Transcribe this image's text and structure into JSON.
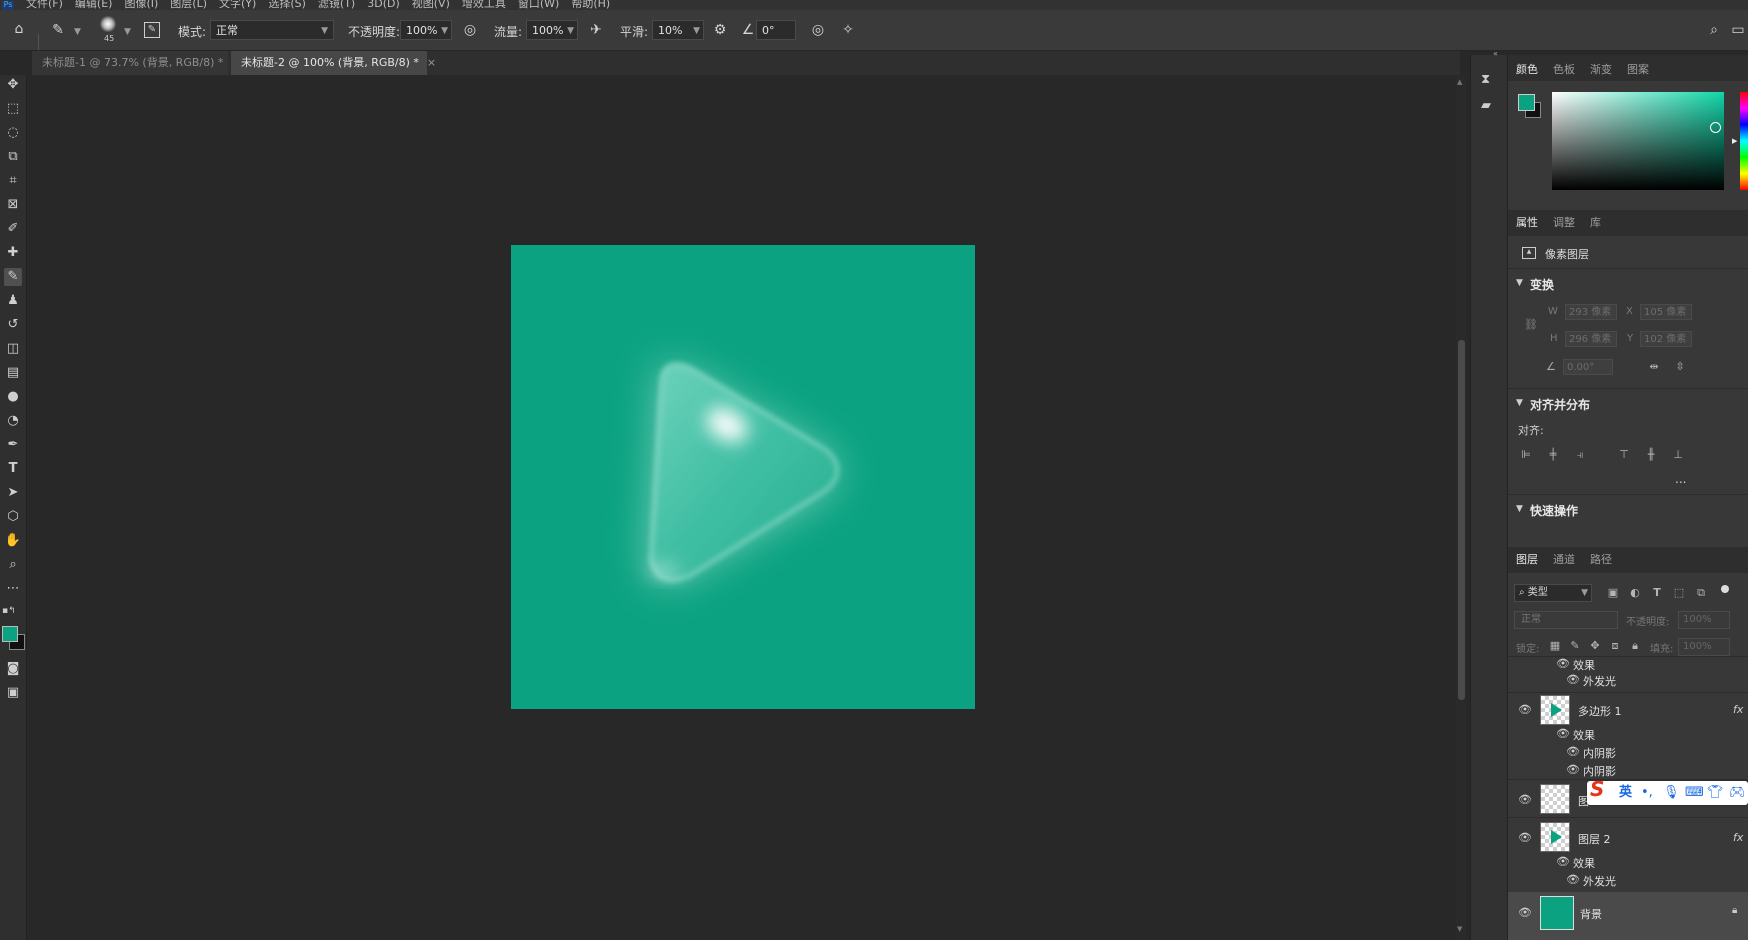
{
  "menu": {
    "items": [
      "文件(F)",
      "编辑(E)",
      "图像(I)",
      "图层(L)",
      "文字(Y)",
      "选择(S)",
      "滤镜(T)",
      "3D(D)",
      "视图(V)",
      "增效工具",
      "窗口(W)",
      "帮助(H)"
    ]
  },
  "options": {
    "brush_size": "45",
    "mode_label": "模式:",
    "mode_value": "正常",
    "opacity_label": "不透明度:",
    "opacity_value": "100%",
    "flow_label": "流量:",
    "flow_value": "100%",
    "smooth_label": "平滑:",
    "smooth_value": "10%",
    "angle_value": "0°"
  },
  "tabs": [
    {
      "label": "未标题-1 @ 73.7% (背景, RGB/8) *",
      "active": false
    },
    {
      "label": "未标题-2 @ 100% (背景, RGB/8) *",
      "active": true
    }
  ],
  "colors": {
    "foreground": "#0aa281",
    "background": "#111111",
    "canvas": "#0aa281"
  },
  "color_panel": {
    "tabs": [
      "颜色",
      "色板",
      "渐变",
      "图案"
    ]
  },
  "properties_panel": {
    "tabs": [
      "属性",
      "调整",
      "库"
    ],
    "layer_type": "像素图层",
    "transform_title": "变换",
    "w_label": "W",
    "w_value": "293 像素",
    "x_label": "X",
    "x_value": "105 像素",
    "h_label": "H",
    "h_value": "296 像素",
    "y_label": "Y",
    "y_value": "102 像素",
    "angle_value": "0.00°",
    "align_title": "对齐并分布",
    "align_label": "对齐:",
    "quick_title": "快速操作",
    "more": "..."
  },
  "layers_panel": {
    "tabs": [
      "图层",
      "通道",
      "路径"
    ],
    "filter_value": "类型",
    "blend_value": "正常",
    "opacity_label": "不透明度:",
    "opacity_value": "100%",
    "lock_label": "锁定:",
    "fill_label": "填充:",
    "fill_value": "100%",
    "effects_label": "效果",
    "effect_outer_glow": "外发光",
    "layer_polygon": "多边形 1",
    "effect_inner_shadow_1": "内阴影",
    "effect_inner_shadow_2": "内阴影",
    "layer_partial": "图",
    "layer_2": "图层 2",
    "layer_2_effects": "效果",
    "layer_2_glow": "外发光",
    "layer_bg": "背景",
    "fx": "fx"
  },
  "ime": {
    "logo": "S",
    "lang": "英"
  }
}
